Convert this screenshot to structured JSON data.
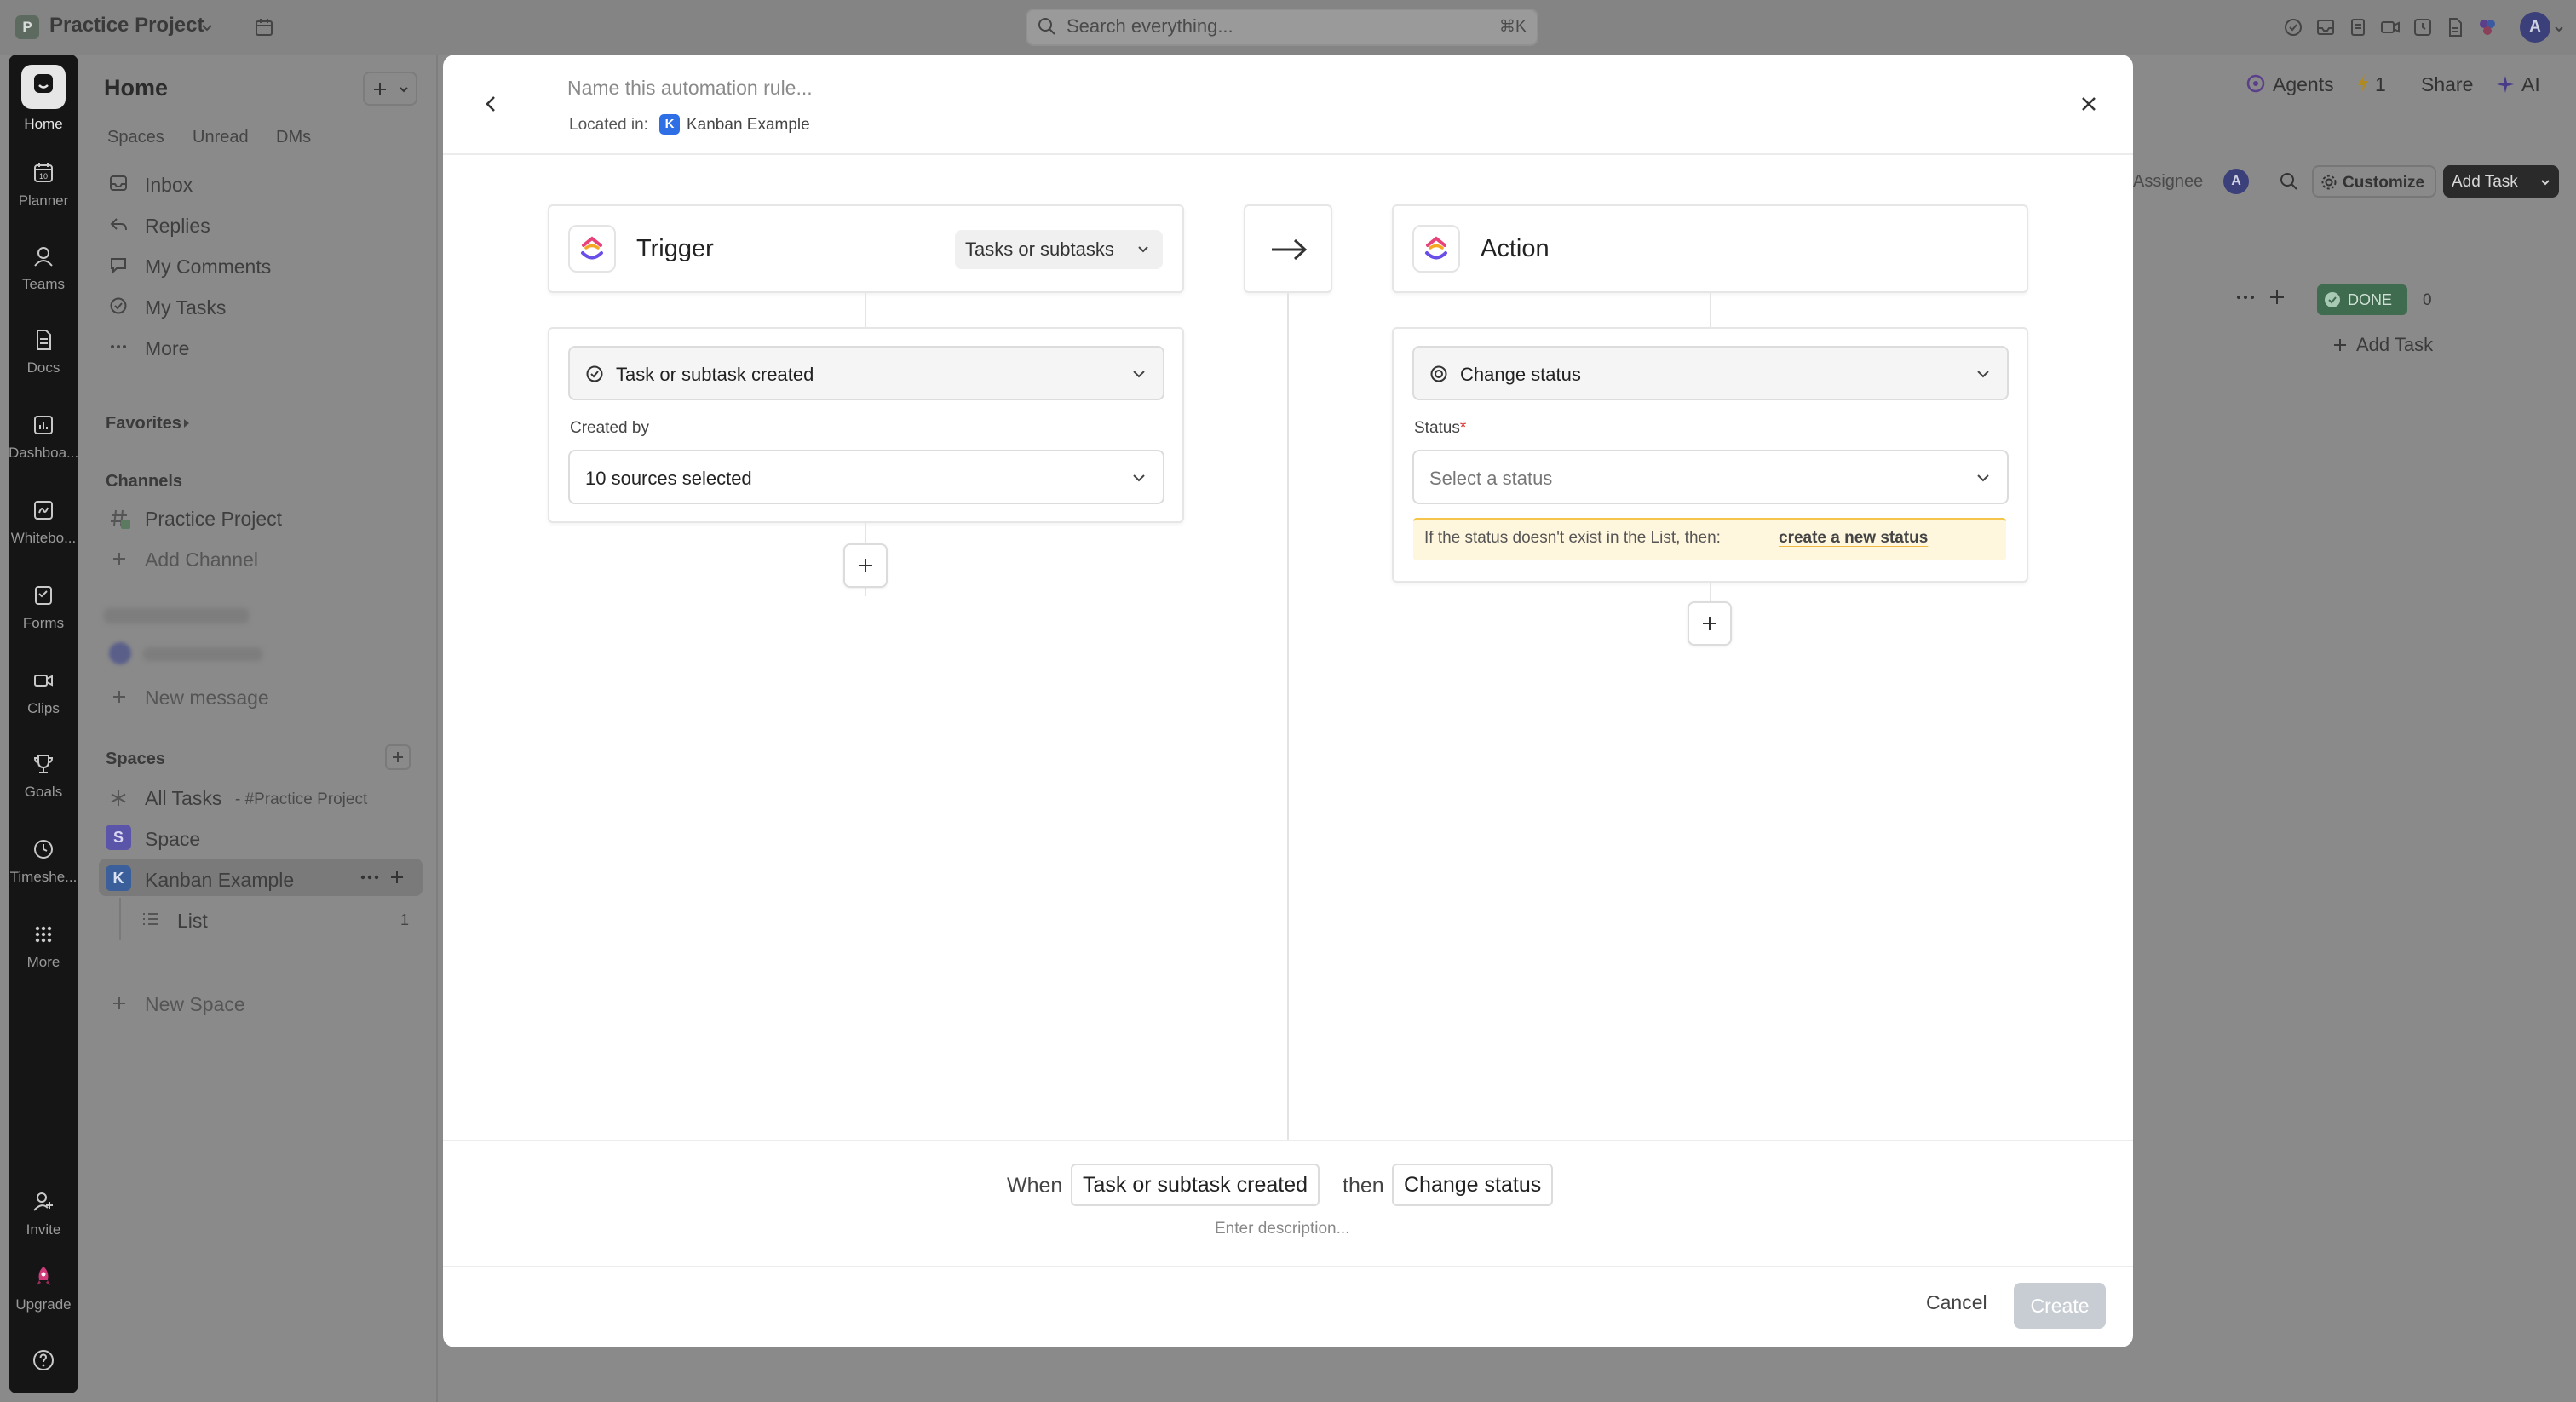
{
  "topbar": {
    "project_initial": "P",
    "project_name": "Practice Project",
    "search_placeholder": "Search everything...",
    "search_shortcut": "⌘K",
    "user_initial": "A"
  },
  "rail": {
    "items": [
      {
        "label": "Home",
        "icon": "home-icon"
      },
      {
        "label": "Planner",
        "icon": "calendar-icon"
      },
      {
        "label": "Teams",
        "icon": "teams-icon"
      },
      {
        "label": "Docs",
        "icon": "doc-icon"
      },
      {
        "label": "Dashboa...",
        "icon": "dashboard-icon"
      },
      {
        "label": "Whitebo...",
        "icon": "whiteboard-icon"
      },
      {
        "label": "Forms",
        "icon": "form-icon"
      },
      {
        "label": "Clips",
        "icon": "clip-icon"
      },
      {
        "label": "Goals",
        "icon": "trophy-icon"
      },
      {
        "label": "Timeshe...",
        "icon": "clock-icon"
      },
      {
        "label": "More",
        "icon": "grid-icon"
      }
    ],
    "invite": "Invite",
    "upgrade": "Upgrade"
  },
  "sidebar": {
    "title": "Home",
    "tabs": [
      "Spaces",
      "Unread",
      "DMs"
    ],
    "nav": [
      "Inbox",
      "Replies",
      "My Comments",
      "My Tasks",
      "More"
    ],
    "favorites": "Favorites",
    "channels_heading": "Channels",
    "channels": [
      "Practice Project",
      "Add Channel"
    ],
    "new_message": "New message",
    "spaces_heading": "Spaces",
    "all_tasks": "All Tasks",
    "all_tasks_sub": "- #Practice Project",
    "space": {
      "initial": "S",
      "name": "Space"
    },
    "kanban": {
      "initial": "K",
      "name": "Kanban Example"
    },
    "list": {
      "name": "List",
      "count": "1"
    },
    "new_space": "New Space"
  },
  "background": {
    "agents": "Agents",
    "lightning_count": "1",
    "share": "Share",
    "ai": "AI",
    "assignee": "Assignee",
    "assignee_initial": "A",
    "customize": "Customize",
    "add_task_btn": "Add Task",
    "done_badge": "DONE",
    "done_count": "0",
    "add_task_link": "Add Task"
  },
  "modal": {
    "rule_name_placeholder": "Name this automation rule...",
    "located_in": "Located in:",
    "location_initial": "K",
    "location_name": "Kanban Example",
    "trigger": {
      "title": "Trigger",
      "scope": "Tasks or subtasks",
      "event": "Task or subtask created",
      "created_by_label": "Created by",
      "created_by_value": "10 sources selected"
    },
    "action": {
      "title": "Action",
      "type": "Change status",
      "status_label": "Status",
      "required_mark": "*",
      "status_placeholder": "Select a status",
      "warning": "If the status doesn't exist in the List, then:",
      "warning_link": "create a new status"
    },
    "summary": {
      "when": "When",
      "trigger": "Task or subtask created",
      "then": "then",
      "action": "Change status",
      "description_placeholder": "Enter description..."
    },
    "cancel": "Cancel",
    "create": "Create"
  },
  "colors": {
    "overlay": "#8a8a8a",
    "rail": "#151515",
    "brand_blue": "#2f6fe6",
    "warning_bg": "#fff6de",
    "warning_border": "#f4c54a",
    "create_disabled": "#c7cdd3"
  }
}
